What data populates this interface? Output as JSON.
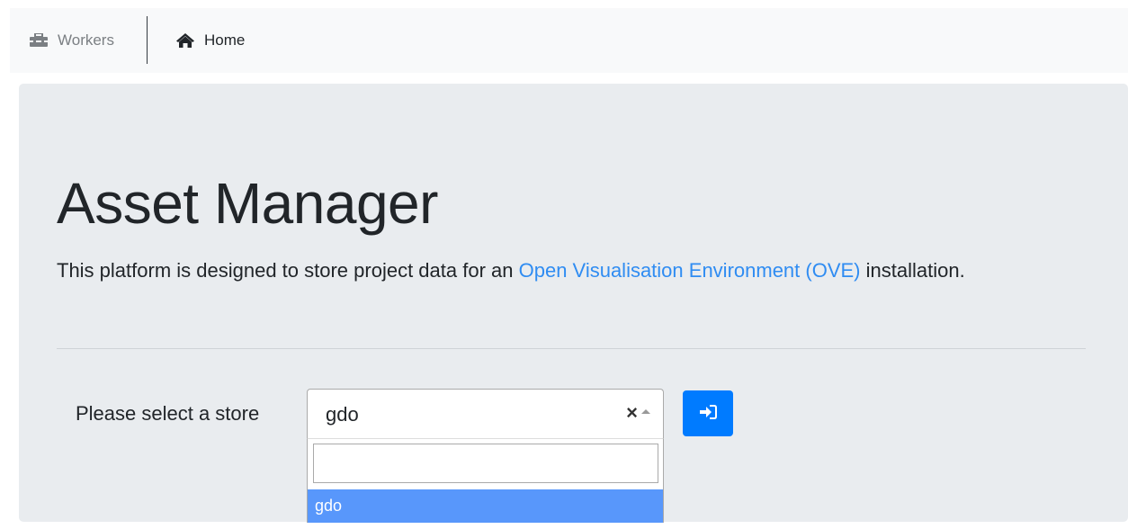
{
  "navbar": {
    "workers": {
      "label": "Workers",
      "icon": "toolbox-icon"
    },
    "home": {
      "label": "Home",
      "icon": "home-icon"
    }
  },
  "jumbotron": {
    "title": "Asset Manager",
    "lead_text_before": "This platform is designed to store project data for an ",
    "lead_link": "Open Visualisation Environment (OVE)",
    "lead_text_after": " installation."
  },
  "store_select": {
    "label": "Please select a store",
    "selected_value": "gdo",
    "clear_glyph": "×",
    "search_value": "",
    "options": [
      "gdo"
    ]
  },
  "go_button": {
    "icon": "sign-in-icon"
  },
  "colors": {
    "primary": "#007bff",
    "link": "#2f8cf2",
    "highlight": "#5897fb",
    "jumbotron_bg": "#e9ecef"
  }
}
